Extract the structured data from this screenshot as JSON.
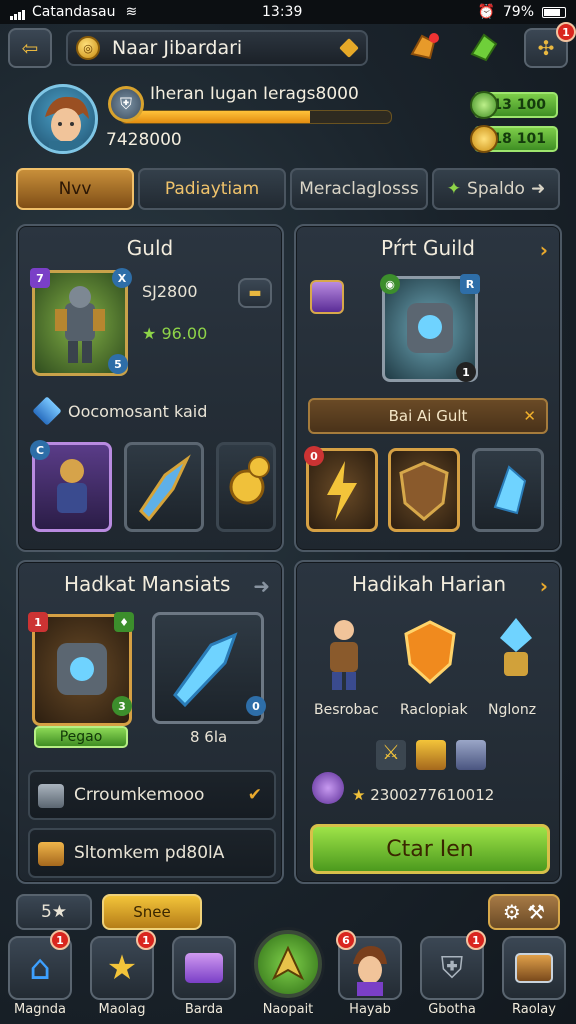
{
  "status_bar": {
    "carrier": "Catandasau",
    "time": "13:39",
    "battery": "79%"
  },
  "top_bar": {
    "title": "Naar Jibardari",
    "badge_count": "1"
  },
  "player": {
    "xp_text": "Iheran Iugan Ierags8000",
    "xp_fill_percent": 70,
    "currency_total": "7428000"
  },
  "resources": [
    {
      "value": "13 100"
    },
    {
      "value": "18 101"
    }
  ],
  "tabs": [
    {
      "label": "Nvv",
      "active": true
    },
    {
      "label": "Padiaytiam"
    },
    {
      "label": "Meraclaglosss"
    },
    {
      "label": "Spaldo"
    }
  ],
  "guild": {
    "title": "Guld",
    "card_level": "7",
    "card_corner": "X",
    "card_small": "5",
    "stat1": "SJ2800",
    "stat2": "96.00",
    "subtitle": "Oocomosant kaid",
    "items": [
      {
        "corner": "C"
      },
      {
        "corner": ""
      },
      {
        "corner": ""
      }
    ]
  },
  "port_guild": {
    "title": "Pŕrt Guild",
    "card_small": "1",
    "action": "Bai Ai Gult",
    "items": [
      {
        "corner": "0"
      },
      {
        "corner": ""
      },
      {
        "corner": ""
      }
    ]
  },
  "hadkat": {
    "title": "Hadkat Mansiats",
    "card1_corner": "1",
    "card1_num": "3",
    "card1_label": "Pegao",
    "card2_num": "0",
    "card2_label": "8 6la",
    "row1": "Crroumkemooo",
    "row2": "Sltomkem pd80lA"
  },
  "hadikah": {
    "title": "Hadikah Harian",
    "heroes": [
      {
        "label": "Besrobac"
      },
      {
        "label": "Raclopiak"
      },
      {
        "label": "Nglonz"
      }
    ],
    "reward_text": "2300277610012",
    "cta": "Ctar Ien"
  },
  "footer_left": {
    "stars": "5★",
    "gold": "Snee"
  },
  "bottom_nav": [
    {
      "label": "Magnda",
      "badge": "1"
    },
    {
      "label": "Maolag",
      "badge": "1"
    },
    {
      "label": "Barda",
      "badge": ""
    },
    {
      "label": "Naopait",
      "badge": ""
    },
    {
      "label": "Hayab",
      "badge": "6"
    },
    {
      "label": "Gbotha",
      "badge": "1"
    },
    {
      "label": "Raolay",
      "badge": ""
    }
  ]
}
